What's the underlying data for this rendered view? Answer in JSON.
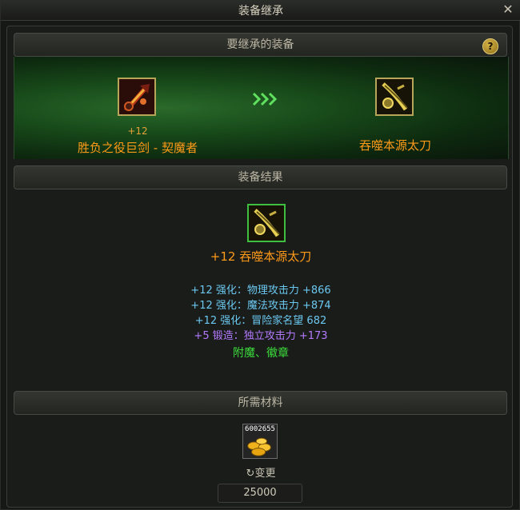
{
  "window": {
    "title": "装备继承",
    "close_icon": "close-icon"
  },
  "sections": {
    "inherit_header": "要继承的装备",
    "result_header": "装备结果",
    "materials_header": "所需材料"
  },
  "source_item": {
    "enhance": "+12",
    "name": "胜负之役巨剑 - 契魔者",
    "icon": "greatsword-icon"
  },
  "target_item": {
    "name": "吞噬本源太刀",
    "icon": "katana-icon"
  },
  "result_item": {
    "title": "+12  吞噬本源太刀",
    "icon": "katana-icon",
    "stats": [
      "+12 强化：物理攻击力 +866",
      "+12 强化：魔法攻击力 +874",
      "+12 强化：冒险家名望 682",
      "+5 锻造：独立攻击力 +173"
    ],
    "extra": "附魔、徽章"
  },
  "materials": {
    "count": "6002655",
    "icon": "gold-coins-icon",
    "change_label": "变更",
    "cost": "25000"
  },
  "colors": {
    "accent_orange": "#ff9a18",
    "stat_blue": "#6bc8f0",
    "stat_purple": "#b37aff",
    "stat_green": "#3cdc3c"
  }
}
